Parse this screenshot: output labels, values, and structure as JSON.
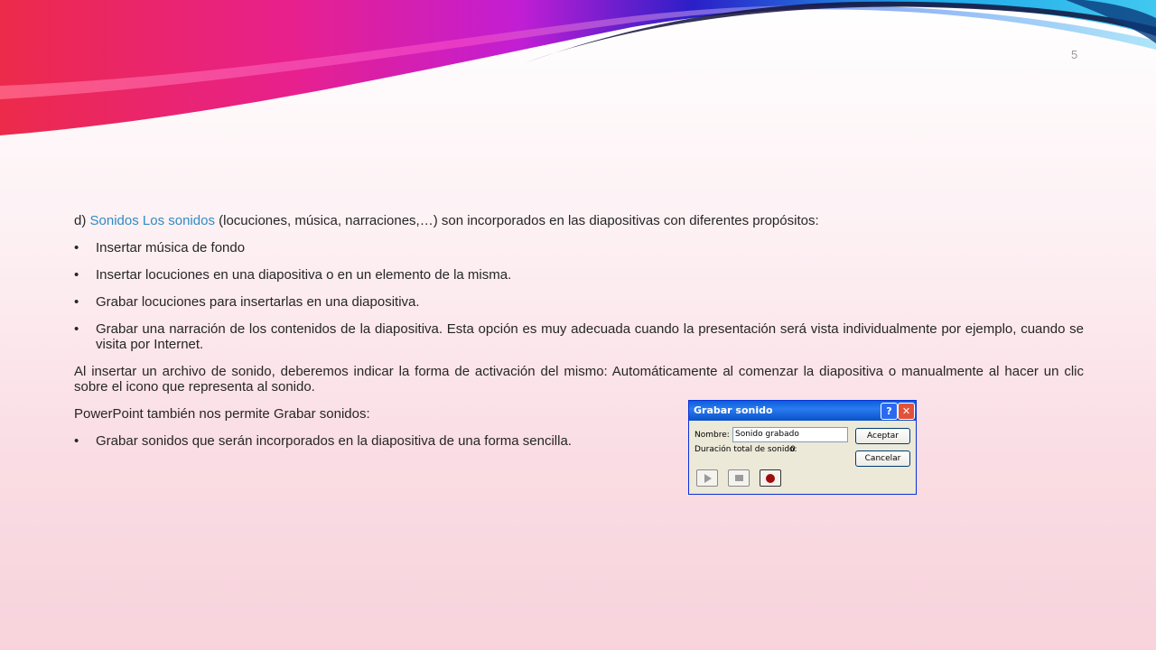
{
  "slide": {
    "page_number": "5"
  },
  "content": {
    "intro_prefix": "d) ",
    "intro_link": "Sonidos Los sonidos",
    "intro_rest": " (locuciones, música, narraciones,…) son incorporados en las diapositivas con diferentes propósitos:",
    "bullets": [
      "Insertar música de fondo",
      "Insertar locuciones en una diapositiva o en un elemento de la misma.",
      "Grabar locuciones para insertarlas en una diapositiva.",
      "Grabar una narración de los contenidos de la diapositiva. Esta opción es muy adecuada cuando la presentación será vista individualmente por ejemplo, cuando se visita por Internet."
    ],
    "paragraph_activation": "Al insertar un archivo de sonido, deberemos indicar la forma de activación del mismo: Automáticamente al comenzar la diapositiva o manualmente al hacer un clic sobre el icono que representa al sonido.",
    "paragraph_record": "PowerPoint también nos permite Grabar sonidos:",
    "bullet_final": "Grabar sonidos que serán incorporados en la diapositiva de una forma sencilla.",
    "bullet_symbol": "•"
  },
  "dialog": {
    "title": "Grabar sonido",
    "help_label": "?",
    "close_label": "✕",
    "name_label": "Nombre:",
    "name_value": "Sonido grabado",
    "duration_label": "Duración total de sonido:",
    "duration_value": "0",
    "ok_label": "Aceptar",
    "cancel_label": "Cancelar",
    "controls": [
      "play-icon",
      "stop-icon",
      "record-icon"
    ]
  },
  "colors": {
    "link": "#2f8bc4",
    "text": "#262626",
    "dialog_title": "#0a5fd8",
    "record": "#a00c0c"
  }
}
